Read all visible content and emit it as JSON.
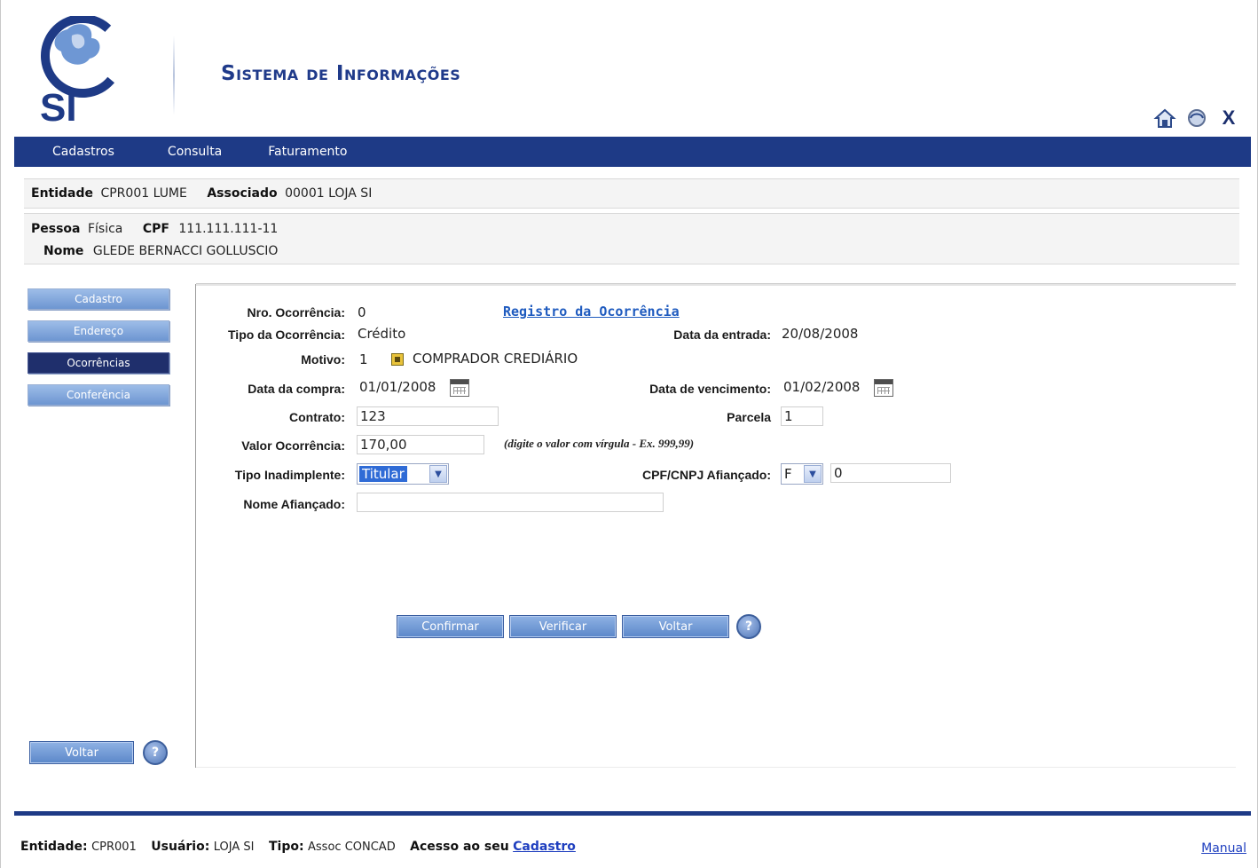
{
  "header": {
    "logo_text": "SI",
    "title": "Sistema de Informações",
    "icons": [
      "home-icon",
      "refresh-icon",
      "close-icon"
    ],
    "close_glyph": "X"
  },
  "menu": [
    "Cadastros",
    "Consulta",
    "Faturamento"
  ],
  "entity_band": {
    "entidade_label": "Entidade",
    "entidade_value": "CPR001 LUME",
    "associado_label": "Associado",
    "associado_value": "00001 LOJA SI"
  },
  "person_band": {
    "pessoa_label": "Pessoa",
    "pessoa_value": "Física",
    "cpf_label": "CPF",
    "cpf_value": "111.111.111-11",
    "nome_label": "Nome",
    "nome_value": "GLEDE BERNACCI GOLLUSCIO"
  },
  "sidebar": {
    "items": [
      {
        "label": "Cadastro",
        "active": false
      },
      {
        "label": "Endereço",
        "active": false
      },
      {
        "label": "Ocorrências",
        "active": true
      },
      {
        "label": "Conferência",
        "active": false
      }
    ],
    "back_label": "Voltar",
    "help_glyph": "?"
  },
  "form": {
    "nro_label": "Nro. Ocorrência:",
    "nro_value": "0",
    "registro_link": "Registro da Ocorrência",
    "tipo_label": "Tipo da Ocorrência:",
    "tipo_value": "Crédito",
    "entrada_label": "Data da entrada:",
    "entrada_value": "20/08/2008",
    "motivo_label": "Motivo:",
    "motivo_code": "1",
    "motivo_desc": "COMPRADOR CREDIÁRIO",
    "compra_label": "Data da compra:",
    "compra_value": "01/01/2008",
    "vencimento_label": "Data de vencimento:",
    "vencimento_value": "01/02/2008",
    "contrato_label": "Contrato:",
    "contrato_value": "123",
    "parcela_label": "Parcela",
    "parcela_value": "1",
    "valor_label": "Valor Ocorrência:",
    "valor_value": "170,00",
    "valor_hint": "(digite o valor com vírgula - Ex. 999,99)",
    "inadimplente_label": "Tipo Inadimplente:",
    "inadimplente_value": "Titular",
    "afiancado_doc_label": "CPF/CNPJ Afiançado:",
    "afiancado_doc_type": "F",
    "afiancado_doc_value": "0",
    "afiancado_nome_label": "Nome Afiançado:",
    "afiancado_nome_value": ""
  },
  "actions": {
    "confirm": "Confirmar",
    "verify": "Verificar",
    "back": "Voltar",
    "help_glyph": "?"
  },
  "footer": {
    "entidade_label": "Entidade:",
    "entidade_value": "CPR001",
    "usuario_label": "Usuário:",
    "usuario_value": "LOJA SI",
    "tipo_label": "Tipo:",
    "tipo_value": "Assoc CONCAD",
    "acesso_label": "Acesso ao seu",
    "cadastro_link": "Cadastro",
    "manual_link": "Manual"
  },
  "colors": {
    "brand_blue": "#1e3a86",
    "link_blue": "#1f5bbf",
    "button_blue": "#5b87c9"
  }
}
